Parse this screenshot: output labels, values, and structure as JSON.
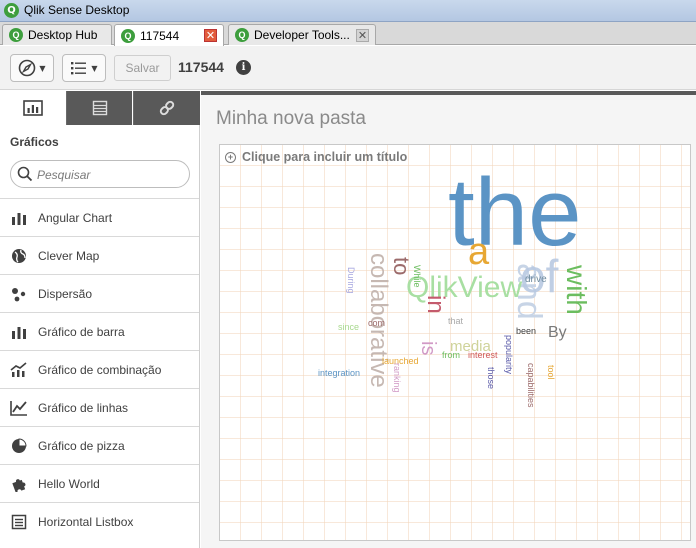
{
  "window": {
    "title": "Qlik Sense Desktop"
  },
  "tabs": [
    {
      "label": "Desktop Hub"
    },
    {
      "label": "117544"
    },
    {
      "label": "Developer Tools..."
    }
  ],
  "toolbar": {
    "save_label": "Salvar",
    "app_name": "117544",
    "info_glyph": "i"
  },
  "panel": {
    "heading": "Gráficos",
    "search_placeholder": "Pesquisar",
    "items": [
      {
        "label": "Angular Chart",
        "icon": "bar-chart-icon"
      },
      {
        "label": "Clever Map",
        "icon": "globe-icon"
      },
      {
        "label": "Dispersão",
        "icon": "scatter-icon"
      },
      {
        "label": "Gráfico de barra",
        "icon": "bar-chart-icon"
      },
      {
        "label": "Gráfico de combinação",
        "icon": "combo-chart-icon"
      },
      {
        "label": "Gráfico de linhas",
        "icon": "line-chart-icon"
      },
      {
        "label": "Gráfico de pizza",
        "icon": "pie-chart-icon"
      },
      {
        "label": "Hello World",
        "icon": "puzzle-icon"
      },
      {
        "label": "Horizontal Listbox",
        "icon": "list-icon"
      }
    ]
  },
  "sheet": {
    "title": "Minha nova pasta",
    "viz_title_prompt": "Clique para incluir um título"
  },
  "word_cloud": {
    "words": [
      "the",
      "QlikView",
      "collaborative",
      "with",
      "and",
      "to",
      "of",
      "a",
      "is",
      "in",
      "drive",
      "media",
      "popularity",
      "integration",
      "from",
      "interest",
      "launched",
      "since",
      "During",
      "tool",
      "capabilities",
      "By",
      "been",
      "those",
      "ranking",
      "While",
      "com",
      "that"
    ]
  },
  "colors": {
    "accent_green": "#3d9e3d",
    "close_red": "#e25c3c",
    "panel_dark": "#595959"
  }
}
